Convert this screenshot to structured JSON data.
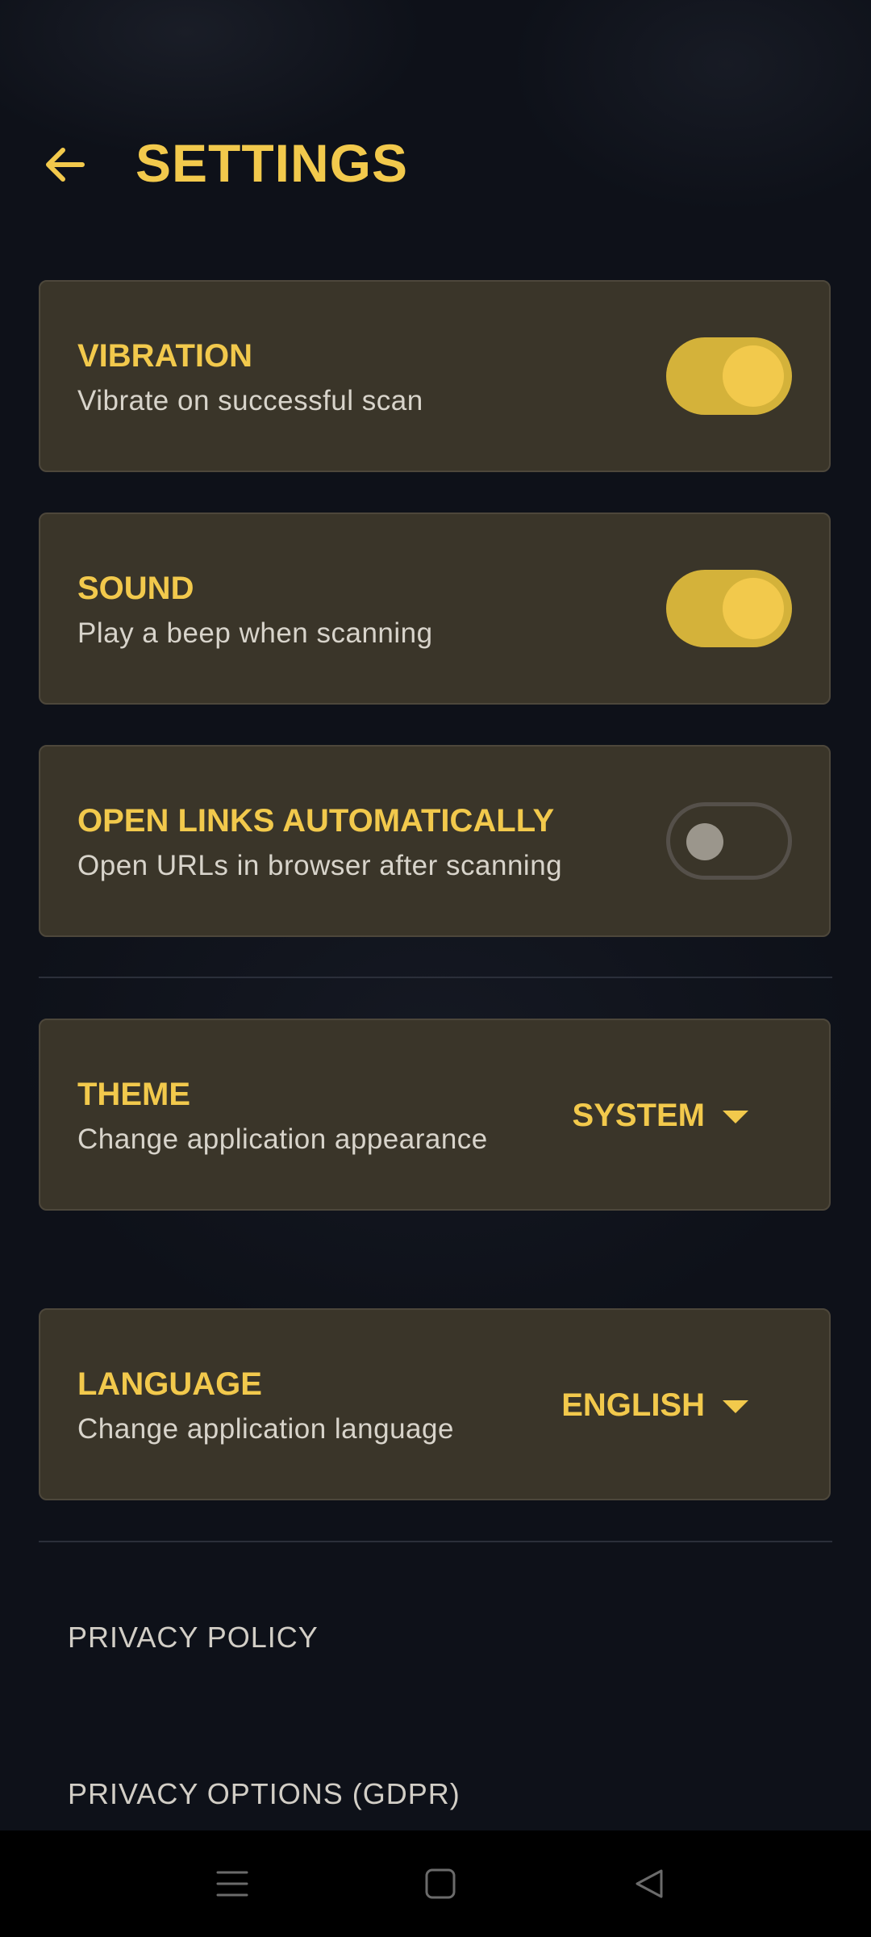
{
  "header": {
    "title": "SETTINGS",
    "back_icon": "arrow-left-icon"
  },
  "settings": {
    "vibration": {
      "title": "VIBRATION",
      "subtitle": "Vibrate on successful scan",
      "enabled": true
    },
    "sound": {
      "title": "SOUND",
      "subtitle": "Play a beep when scanning",
      "enabled": true
    },
    "open_links": {
      "title": "OPEN LINKS AUTOMATICALLY",
      "subtitle": "Open URLs in browser after scanning",
      "enabled": false
    },
    "theme": {
      "title": "THEME",
      "subtitle": "Change application appearance",
      "value": "SYSTEM"
    },
    "language": {
      "title": "LANGUAGE",
      "subtitle": "Change application language",
      "value": "ENGLISH"
    }
  },
  "links": {
    "privacy_policy": "PRIVACY POLICY",
    "privacy_options": "PRIVACY OPTIONS (GDPR)"
  },
  "colors": {
    "accent": "#f2c94c",
    "card_background": "#3a3529",
    "page_background": "#0e1119"
  },
  "system_nav": {
    "icons": [
      "menu-icon",
      "home-icon",
      "back-icon"
    ]
  }
}
